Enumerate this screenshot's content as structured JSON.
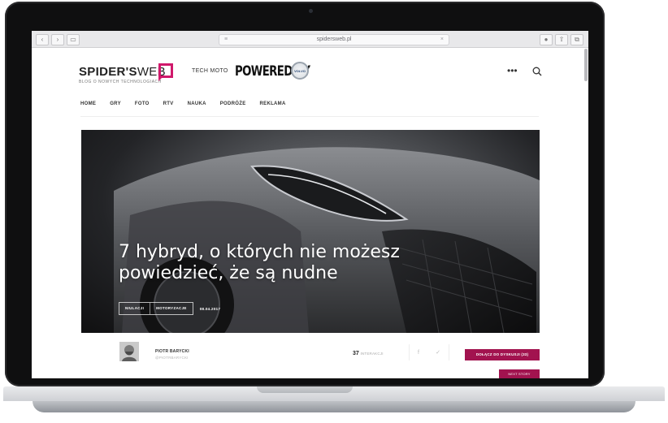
{
  "browser": {
    "url": "spidersweb.pl"
  },
  "site": {
    "logo_main": "SPIDER'S",
    "logo_suffix": "WEB",
    "logo_sub": "BLOG O NOWYCH TECHNOLOGIACH",
    "section": "TECH MOTO",
    "powered_by": "POWERED BY",
    "sponsor_logo": "VOLVO"
  },
  "nav": {
    "items": [
      "HOME",
      "GRY",
      "FOTO",
      "RTV",
      "NAUKA",
      "PODRÓŻE",
      "REKLAMA"
    ]
  },
  "article": {
    "title": "7 hybryd, o których nie możesz powiedzieć, że są nudne",
    "tags": [
      "NIULACJI",
      "MOTORYZACJE"
    ],
    "date": "08.04.2017"
  },
  "author": {
    "name": "PIOTR BARYCKI",
    "handle": "@PIOTRBARYCKI"
  },
  "engagement": {
    "count": "37",
    "label": "INTERAKCJI",
    "discuss_button": "DOŁĄCZ DO DYSKUSJI (33)",
    "next_button": "NEXT STORY"
  },
  "colors": {
    "brand": "#d0196b",
    "button": "#a2134f"
  }
}
